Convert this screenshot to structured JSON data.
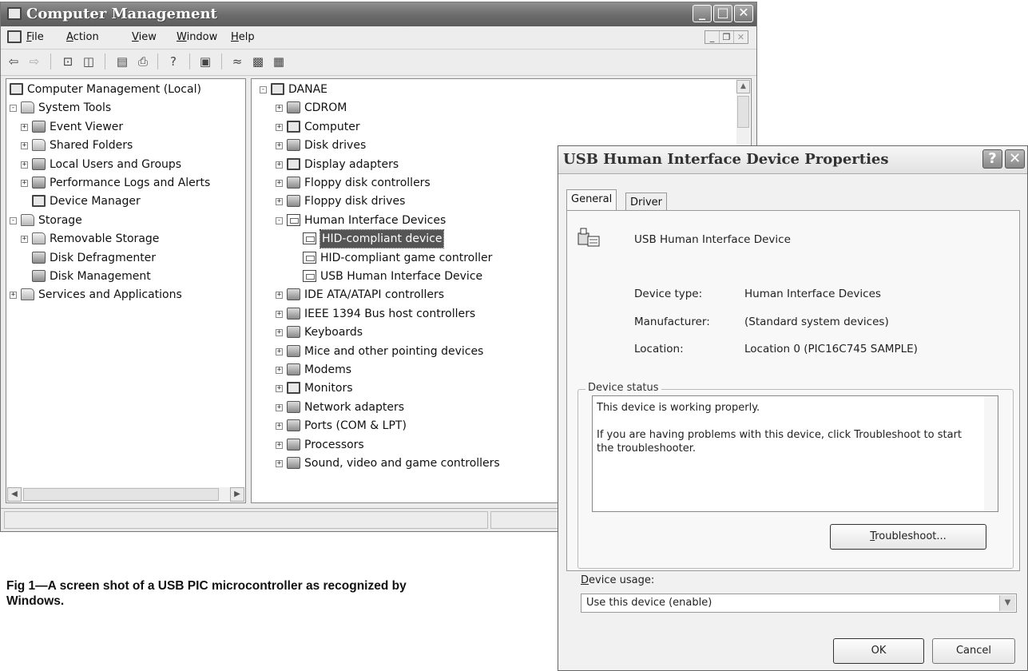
{
  "main_window": {
    "title": "Computer Management",
    "menu": [
      "File",
      "Action",
      "View",
      "Window",
      "Help"
    ],
    "menu_underline": [
      "F",
      "A",
      "V",
      "W",
      "H"
    ],
    "toolbar_icons": [
      "back-icon",
      "forward-icon",
      "up-folder-icon",
      "show-hide-tree-icon",
      "properties-icon",
      "print-icon",
      "help-icon",
      "device-manager-icon",
      "scan-hardware-icon",
      "update-driver-icon",
      "uninstall-icon"
    ],
    "left_tree": [
      {
        "label": "Computer Management (Local)",
        "level": 0,
        "icon": "computer-icon"
      },
      {
        "label": "System Tools",
        "level": 1,
        "icon": "tools-icon",
        "expander": "-"
      },
      {
        "label": "Event Viewer",
        "level": 2,
        "icon": "event-viewer-icon",
        "expander": "+"
      },
      {
        "label": "Shared Folders",
        "level": 2,
        "icon": "shared-folder-icon",
        "expander": "+"
      },
      {
        "label": "Local Users and Groups",
        "level": 2,
        "icon": "users-icon",
        "expander": "+"
      },
      {
        "label": "Performance Logs and Alerts",
        "level": 2,
        "icon": "performance-icon",
        "expander": "+"
      },
      {
        "label": "Device Manager",
        "level": 2,
        "icon": "device-manager-icon"
      },
      {
        "label": "Storage",
        "level": 1,
        "icon": "storage-icon",
        "expander": "-"
      },
      {
        "label": "Removable Storage",
        "level": 2,
        "icon": "removable-storage-icon",
        "expander": "+"
      },
      {
        "label": "Disk Defragmenter",
        "level": 2,
        "icon": "defrag-icon"
      },
      {
        "label": "Disk Management",
        "level": 2,
        "icon": "disk-management-icon"
      },
      {
        "label": "Services and Applications",
        "level": 1,
        "icon": "services-icon",
        "expander": "+"
      }
    ],
    "right_tree": [
      {
        "label": "DANAE",
        "level": 0,
        "icon": "computer-icon",
        "expander": "-"
      },
      {
        "label": "CDROM",
        "level": 1,
        "icon": "cdrom-icon",
        "expander": "+"
      },
      {
        "label": "Computer",
        "level": 1,
        "icon": "computer-icon",
        "expander": "+"
      },
      {
        "label": "Disk drives",
        "level": 1,
        "icon": "disk-drive-icon",
        "expander": "+"
      },
      {
        "label": "Display adapters",
        "level": 1,
        "icon": "display-adapter-icon",
        "expander": "+"
      },
      {
        "label": "Floppy disk controllers",
        "level": 1,
        "icon": "floppy-controller-icon",
        "expander": "+"
      },
      {
        "label": "Floppy disk drives",
        "level": 1,
        "icon": "floppy-drive-icon",
        "expander": "+"
      },
      {
        "label": "Human Interface Devices",
        "level": 1,
        "icon": "hid-icon",
        "expander": "-"
      },
      {
        "label": "HID-compliant device",
        "level": 2,
        "icon": "hid-icon",
        "selected": true
      },
      {
        "label": "HID-compliant game controller",
        "level": 2,
        "icon": "hid-icon"
      },
      {
        "label": "USB Human Interface Device",
        "level": 2,
        "icon": "hid-icon"
      },
      {
        "label": "IDE ATA/ATAPI controllers",
        "level": 1,
        "icon": "ide-icon",
        "expander": "+"
      },
      {
        "label": "IEEE 1394 Bus host controllers",
        "level": 1,
        "icon": "ieee1394-icon",
        "expander": "+"
      },
      {
        "label": "Keyboards",
        "level": 1,
        "icon": "keyboard-icon",
        "expander": "+"
      },
      {
        "label": "Mice and other pointing devices",
        "level": 1,
        "icon": "mouse-icon",
        "expander": "+"
      },
      {
        "label": "Modems",
        "level": 1,
        "icon": "modem-icon",
        "expander": "+"
      },
      {
        "label": "Monitors",
        "level": 1,
        "icon": "monitor-icon",
        "expander": "+"
      },
      {
        "label": "Network adapters",
        "level": 1,
        "icon": "network-adapter-icon",
        "expander": "+"
      },
      {
        "label": "Ports (COM & LPT)",
        "level": 1,
        "icon": "port-icon",
        "expander": "+"
      },
      {
        "label": "Processors",
        "level": 1,
        "icon": "processor-icon",
        "expander": "+"
      },
      {
        "label": "Sound, video and game controllers",
        "level": 1,
        "icon": "sound-icon",
        "expander": "+"
      }
    ]
  },
  "dialog": {
    "title": "USB Human Interface Device Properties",
    "help_glyph": "?",
    "close_glyph": "✕",
    "tabs": [
      "General",
      "Driver"
    ],
    "device_name": "USB Human Interface Device",
    "props": [
      {
        "label": "Device type:",
        "value": "Human Interface Devices"
      },
      {
        "label": "Manufacturer:",
        "value": "(Standard system devices)"
      },
      {
        "label": "Location:",
        "value": "Location 0 (PIC16C745 SAMPLE)"
      }
    ],
    "status_legend": "Device status",
    "status_line1": "This device is working properly.",
    "status_line2": "If you are having problems with this device, click Troubleshoot to start the troubleshooter.",
    "troubleshoot_label": "Troubleshoot...",
    "usage_label": "Device usage:",
    "usage_value": "Use this device (enable)",
    "ok_label": "OK",
    "cancel_label": "Cancel"
  },
  "caption": "Fig 1—A screen shot of a USB PIC microcontroller as recognized by Windows."
}
